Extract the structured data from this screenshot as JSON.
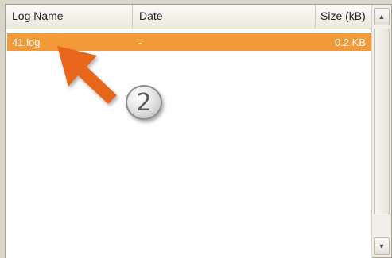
{
  "table": {
    "columns": [
      {
        "label": "Log Name"
      },
      {
        "label": "Date"
      },
      {
        "label": "Size (kB)"
      }
    ],
    "rows": [
      {
        "name": "41.log",
        "date": "-",
        "size": "0.2 KB",
        "selected": true
      }
    ]
  },
  "annotation": {
    "step_number": "2",
    "arrow_color": "#e8661b"
  },
  "colors": {
    "selection": "#f39a38"
  },
  "scrollbar": {
    "up_icon": "scroll-up-arrow-icon",
    "down_icon": "scroll-down-arrow-icon"
  }
}
